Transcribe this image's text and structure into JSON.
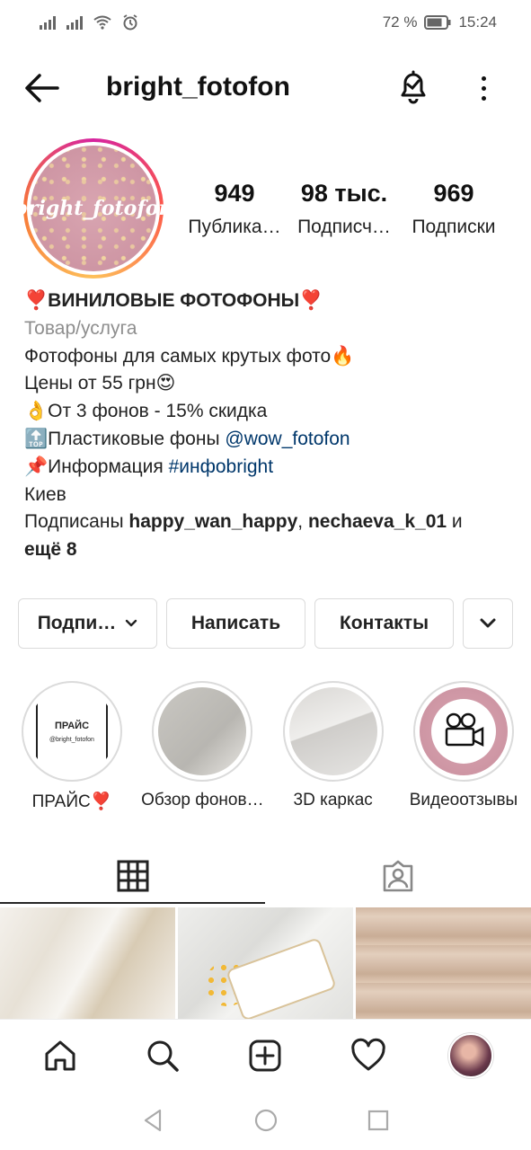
{
  "status_bar": {
    "battery": "72 %",
    "time": "15:24"
  },
  "header": {
    "username": "bright_fotofon"
  },
  "avatar": {
    "text": "bright_fotofon"
  },
  "stats": [
    {
      "value": "949",
      "label": "Публика…"
    },
    {
      "value": "98 тыс.",
      "label": "Подписч…"
    },
    {
      "value": "969",
      "label": "Подписки"
    }
  ],
  "bio": {
    "name": "❣️ВИНИЛОВЫЕ ФОТОФОНЫ❣️",
    "category": "Товар/услуга",
    "line1": "Фотофоны для самых крутых фото🔥",
    "line2": "Цены от 55 грн😍",
    "line3": "👌От 3 фонов - 15% скидка",
    "line4_prefix": "🔝Пластиковые фоны ",
    "line4_link": "@wow_fotofon",
    "line5_prefix": "📌Информация ",
    "line5_link": "#инфоbright",
    "city": "Киев",
    "followed_prefix": "Подписаны ",
    "followed_user1": "happy_wan_happy",
    "followed_sep": ", ",
    "followed_user2": "nechaeva_k_01",
    "followed_and": " и",
    "followed_more": "ещё 8"
  },
  "buttons": {
    "follow": "Подпи…",
    "message": "Написать",
    "contacts": "Контакты"
  },
  "highlights": [
    {
      "label": "ПРАЙС❣️",
      "cover_title": "ПРАЙС",
      "cover_sub": "@bright_fotofon"
    },
    {
      "label": "Обзор фонов…"
    },
    {
      "label": "3D каркас"
    },
    {
      "label": "Видеоотзывы"
    }
  ],
  "icons": {
    "back": "arrow-left-icon",
    "bell": "bell-check-icon",
    "more": "more-vertical-icon",
    "grid": "grid-icon",
    "tagged": "tagged-person-icon",
    "home": "home-icon",
    "search": "search-icon",
    "add": "add-post-icon",
    "heart": "heart-icon"
  }
}
